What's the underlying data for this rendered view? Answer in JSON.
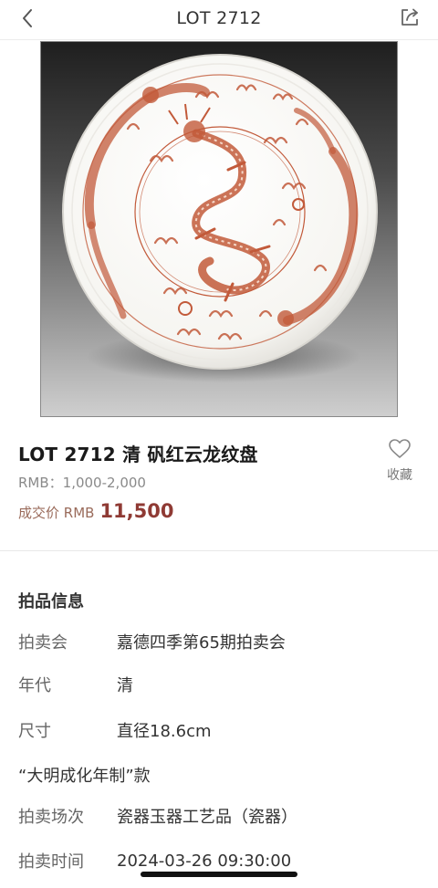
{
  "nav": {
    "title": "LOT 2712",
    "back_icon": "chevron-left-icon",
    "share_icon": "share-icon"
  },
  "hero": {
    "description_icon": "porcelain-dragon-plate-image"
  },
  "lot": {
    "title": "LOT 2712 清  矾红云龙纹盘",
    "estimate": "RMB：1,000-2,000",
    "price_label": "成交价 RMB",
    "price_value": "11,500",
    "favorite_label": "收藏",
    "favorite_icon": "heart-outline-icon"
  },
  "info": {
    "section_title": "拍品信息",
    "rows": [
      {
        "label": "拍卖会",
        "value": "嘉德四季第65期拍卖会"
      },
      {
        "label": "年代",
        "value": "清"
      },
      {
        "label": "尺寸",
        "value": "直径18.6cm"
      }
    ],
    "mark": "“大明成化年制”款",
    "rows2": [
      {
        "label": "拍卖场次",
        "value": "瓷器玉器工艺品（瓷器）"
      },
      {
        "label": "拍卖时间",
        "value": "2024-03-26 09:30:00"
      }
    ]
  },
  "colors": {
    "price": "#8f3a34",
    "price_label": "#9a6b5b",
    "dragon_red": "#c25a3a"
  }
}
